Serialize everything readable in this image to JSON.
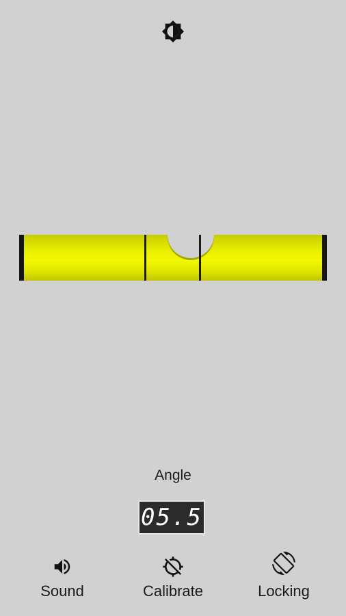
{
  "header": {
    "brightness_icon": "brightness-icon"
  },
  "level": {
    "colors": {
      "tube": "#e9ef00",
      "bubble": "#d1d1d1",
      "marker": "#1a1a1a"
    }
  },
  "angle": {
    "label": "Angle",
    "value": "05.5"
  },
  "actions": [
    {
      "label": "Sound",
      "icon": "volume-icon"
    },
    {
      "label": "Calibrate",
      "icon": "gps-crosshair-off-icon"
    },
    {
      "label": "Locking",
      "icon": "screen-rotation-icon"
    }
  ]
}
